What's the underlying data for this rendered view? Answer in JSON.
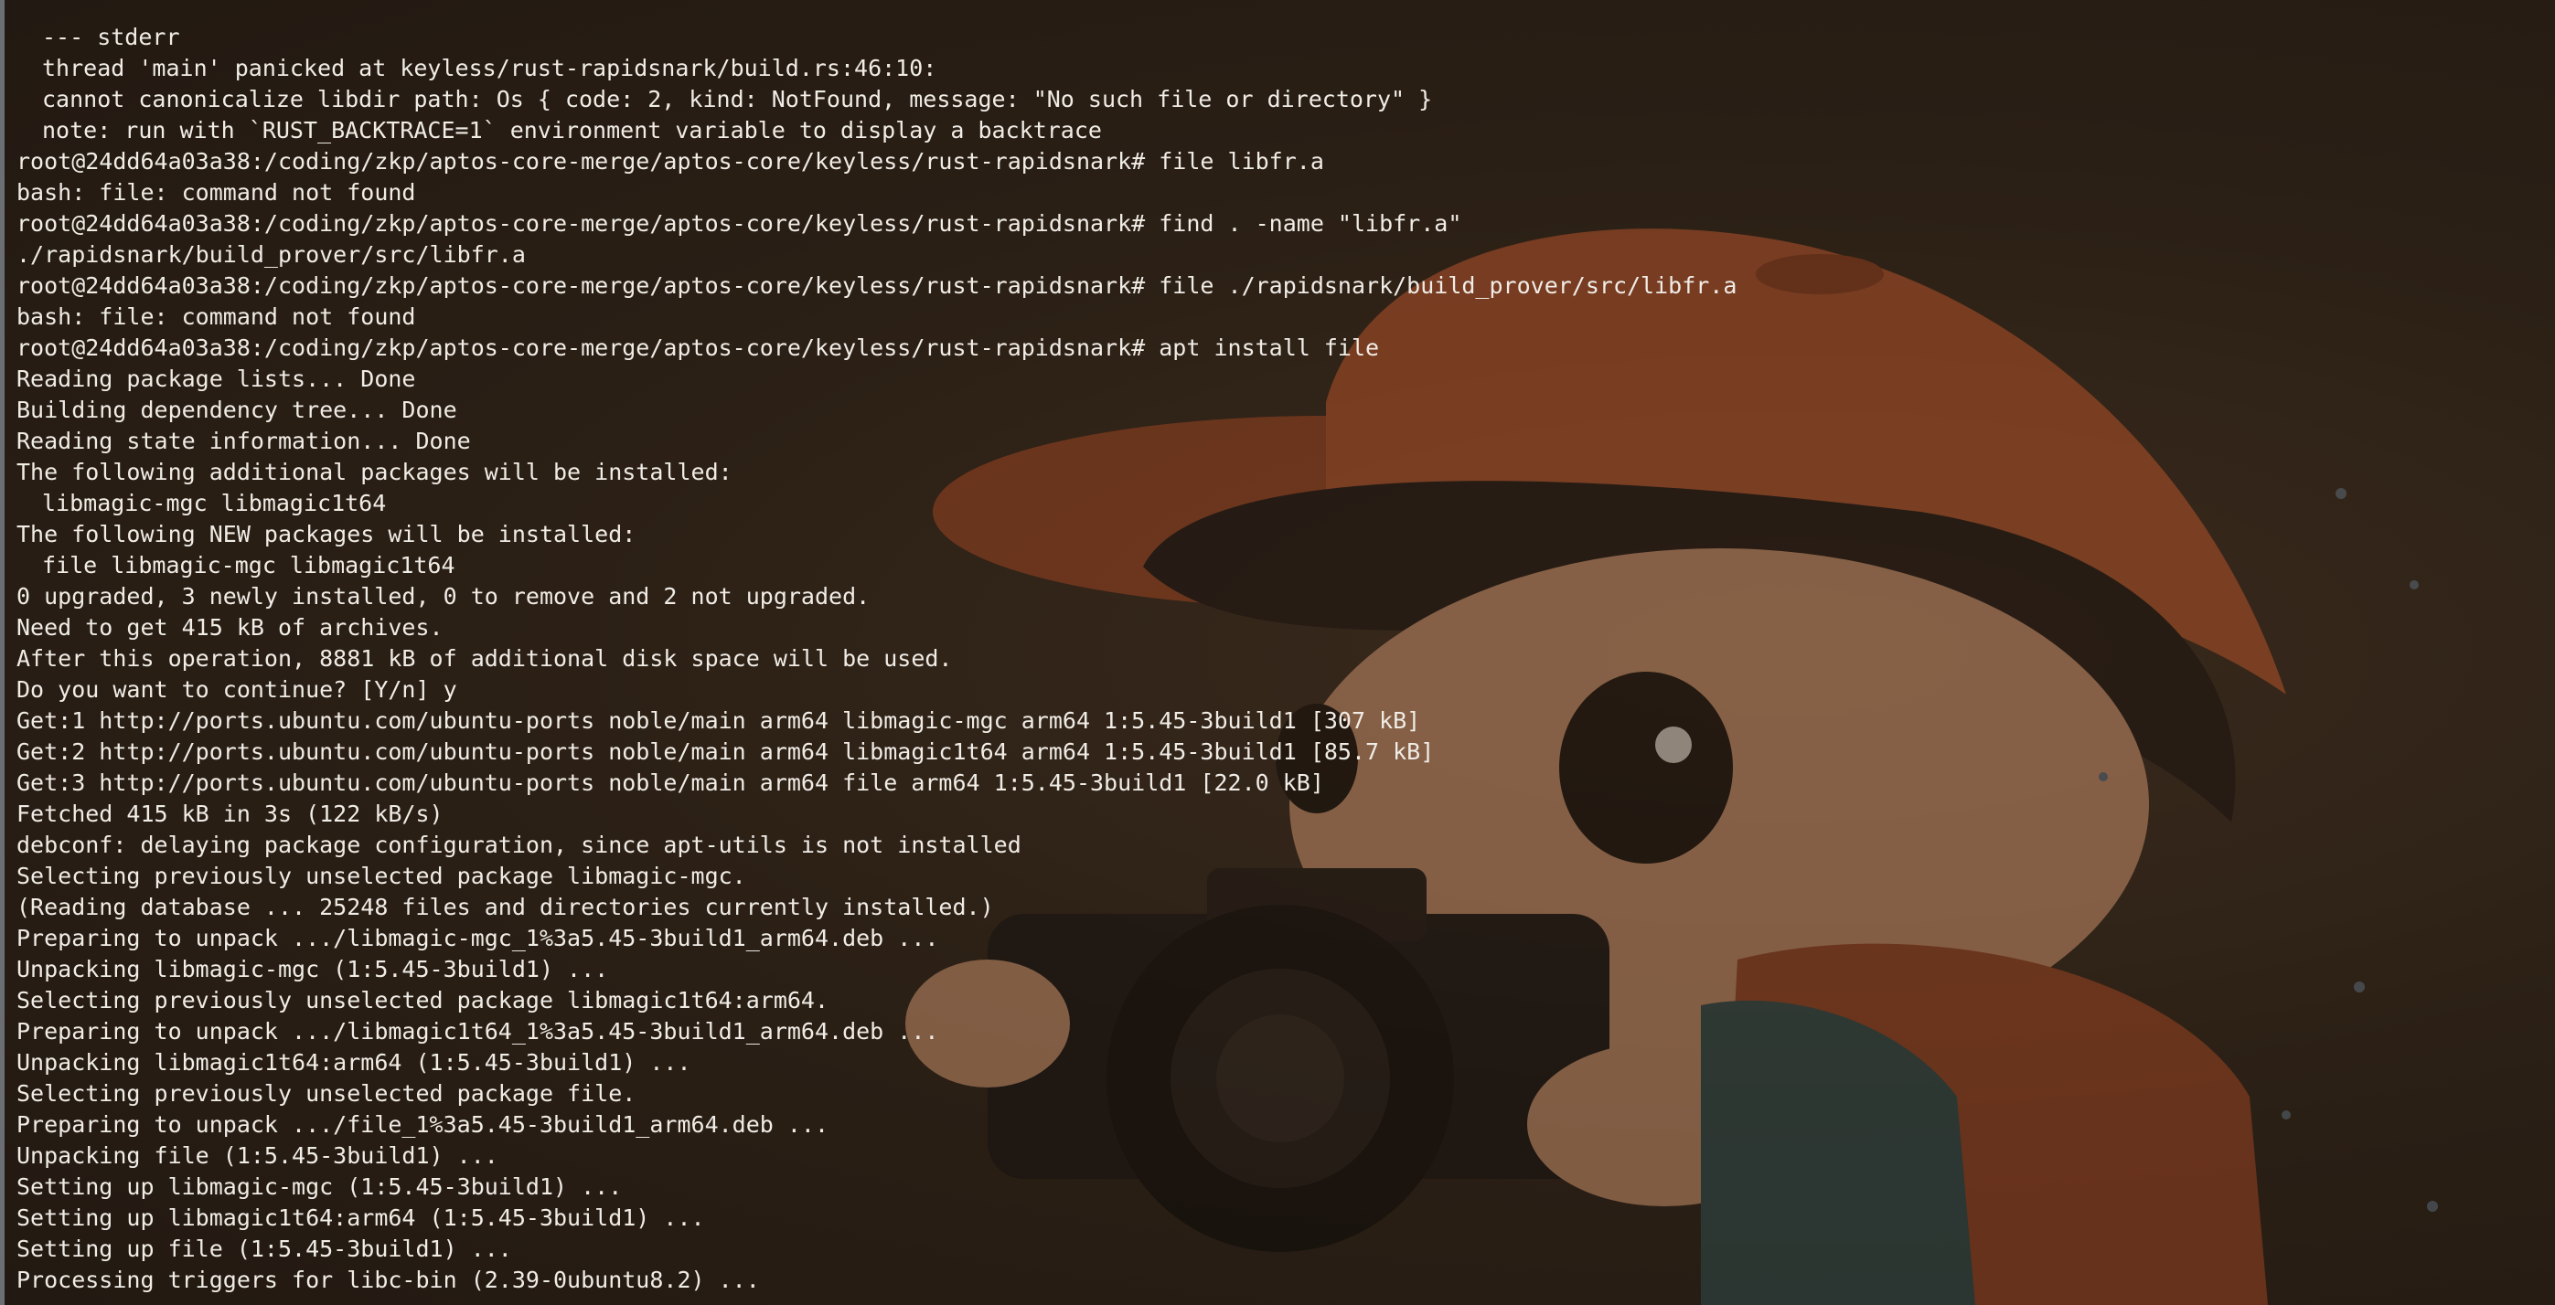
{
  "terminal": {
    "prompt": "root@24dd64a03a38:/coding/zkp/aptos-core-merge/aptos-core/keyless/rust-rapidsnark#",
    "lines": [
      {
        "text": "--- stderr",
        "indent": true
      },
      {
        "text": "thread 'main' panicked at keyless/rust-rapidsnark/build.rs:46:10:",
        "indent": true
      },
      {
        "text": "cannot canonicalize libdir path: Os { code: 2, kind: NotFound, message: \"No such file or directory\" }",
        "indent": true
      },
      {
        "text": "note: run with `RUST_BACKTRACE=1` environment variable to display a backtrace",
        "indent": true
      },
      {
        "text": "root@24dd64a03a38:/coding/zkp/aptos-core-merge/aptos-core/keyless/rust-rapidsnark# file libfr.a",
        "indent": false
      },
      {
        "text": "bash: file: command not found",
        "indent": false
      },
      {
        "text": "root@24dd64a03a38:/coding/zkp/aptos-core-merge/aptos-core/keyless/rust-rapidsnark# find . -name \"libfr.a\"",
        "indent": false
      },
      {
        "text": "./rapidsnark/build_prover/src/libfr.a",
        "indent": false
      },
      {
        "text": "root@24dd64a03a38:/coding/zkp/aptos-core-merge/aptos-core/keyless/rust-rapidsnark# file ./rapidsnark/build_prover/src/libfr.a",
        "indent": false
      },
      {
        "text": "bash: file: command not found",
        "indent": false
      },
      {
        "text": "root@24dd64a03a38:/coding/zkp/aptos-core-merge/aptos-core/keyless/rust-rapidsnark# apt install file",
        "indent": false
      },
      {
        "text": "Reading package lists... Done",
        "indent": false
      },
      {
        "text": "Building dependency tree... Done",
        "indent": false
      },
      {
        "text": "Reading state information... Done",
        "indent": false
      },
      {
        "text": "The following additional packages will be installed:",
        "indent": false
      },
      {
        "text": "libmagic-mgc libmagic1t64",
        "indent": true
      },
      {
        "text": "The following NEW packages will be installed:",
        "indent": false
      },
      {
        "text": "file libmagic-mgc libmagic1t64",
        "indent": true
      },
      {
        "text": "0 upgraded, 3 newly installed, 0 to remove and 2 not upgraded.",
        "indent": false
      },
      {
        "text": "Need to get 415 kB of archives.",
        "indent": false
      },
      {
        "text": "After this operation, 8881 kB of additional disk space will be used.",
        "indent": false
      },
      {
        "text": "Do you want to continue? [Y/n] y",
        "indent": false
      },
      {
        "text": "Get:1 http://ports.ubuntu.com/ubuntu-ports noble/main arm64 libmagic-mgc arm64 1:5.45-3build1 [307 kB]",
        "indent": false
      },
      {
        "text": "Get:2 http://ports.ubuntu.com/ubuntu-ports noble/main arm64 libmagic1t64 arm64 1:5.45-3build1 [85.7 kB]",
        "indent": false
      },
      {
        "text": "Get:3 http://ports.ubuntu.com/ubuntu-ports noble/main arm64 file arm64 1:5.45-3build1 [22.0 kB]",
        "indent": false
      },
      {
        "text": "Fetched 415 kB in 3s (122 kB/s)",
        "indent": false
      },
      {
        "text": "debconf: delaying package configuration, since apt-utils is not installed",
        "indent": false
      },
      {
        "text": "Selecting previously unselected package libmagic-mgc.",
        "indent": false
      },
      {
        "text": "(Reading database ... 25248 files and directories currently installed.)",
        "indent": false
      },
      {
        "text": "Preparing to unpack .../libmagic-mgc_1%3a5.45-3build1_arm64.deb ...",
        "indent": false
      },
      {
        "text": "Unpacking libmagic-mgc (1:5.45-3build1) ...",
        "indent": false
      },
      {
        "text": "Selecting previously unselected package libmagic1t64:arm64.",
        "indent": false
      },
      {
        "text": "Preparing to unpack .../libmagic1t64_1%3a5.45-3build1_arm64.deb ...",
        "indent": false
      },
      {
        "text": "Unpacking libmagic1t64:arm64 (1:5.45-3build1) ...",
        "indent": false
      },
      {
        "text": "Selecting previously unselected package file.",
        "indent": false
      },
      {
        "text": "Preparing to unpack .../file_1%3a5.45-3build1_arm64.deb ...",
        "indent": false
      },
      {
        "text": "Unpacking file (1:5.45-3build1) ...",
        "indent": false
      },
      {
        "text": "Setting up libmagic-mgc (1:5.45-3build1) ...",
        "indent": false
      },
      {
        "text": "Setting up libmagic1t64:arm64 (1:5.45-3build1) ...",
        "indent": false
      },
      {
        "text": "Setting up file (1:5.45-3build1) ...",
        "indent": false
      },
      {
        "text": "Processing triggers for libc-bin (2.39-0ubuntu8.2) ...",
        "indent": false
      }
    ]
  },
  "colors": {
    "text": "#f0ece6",
    "background": "#2a1f15",
    "cap": "#b4532a",
    "skin": "#e8b48a"
  },
  "background_image": "boy-with-camera-illustration"
}
